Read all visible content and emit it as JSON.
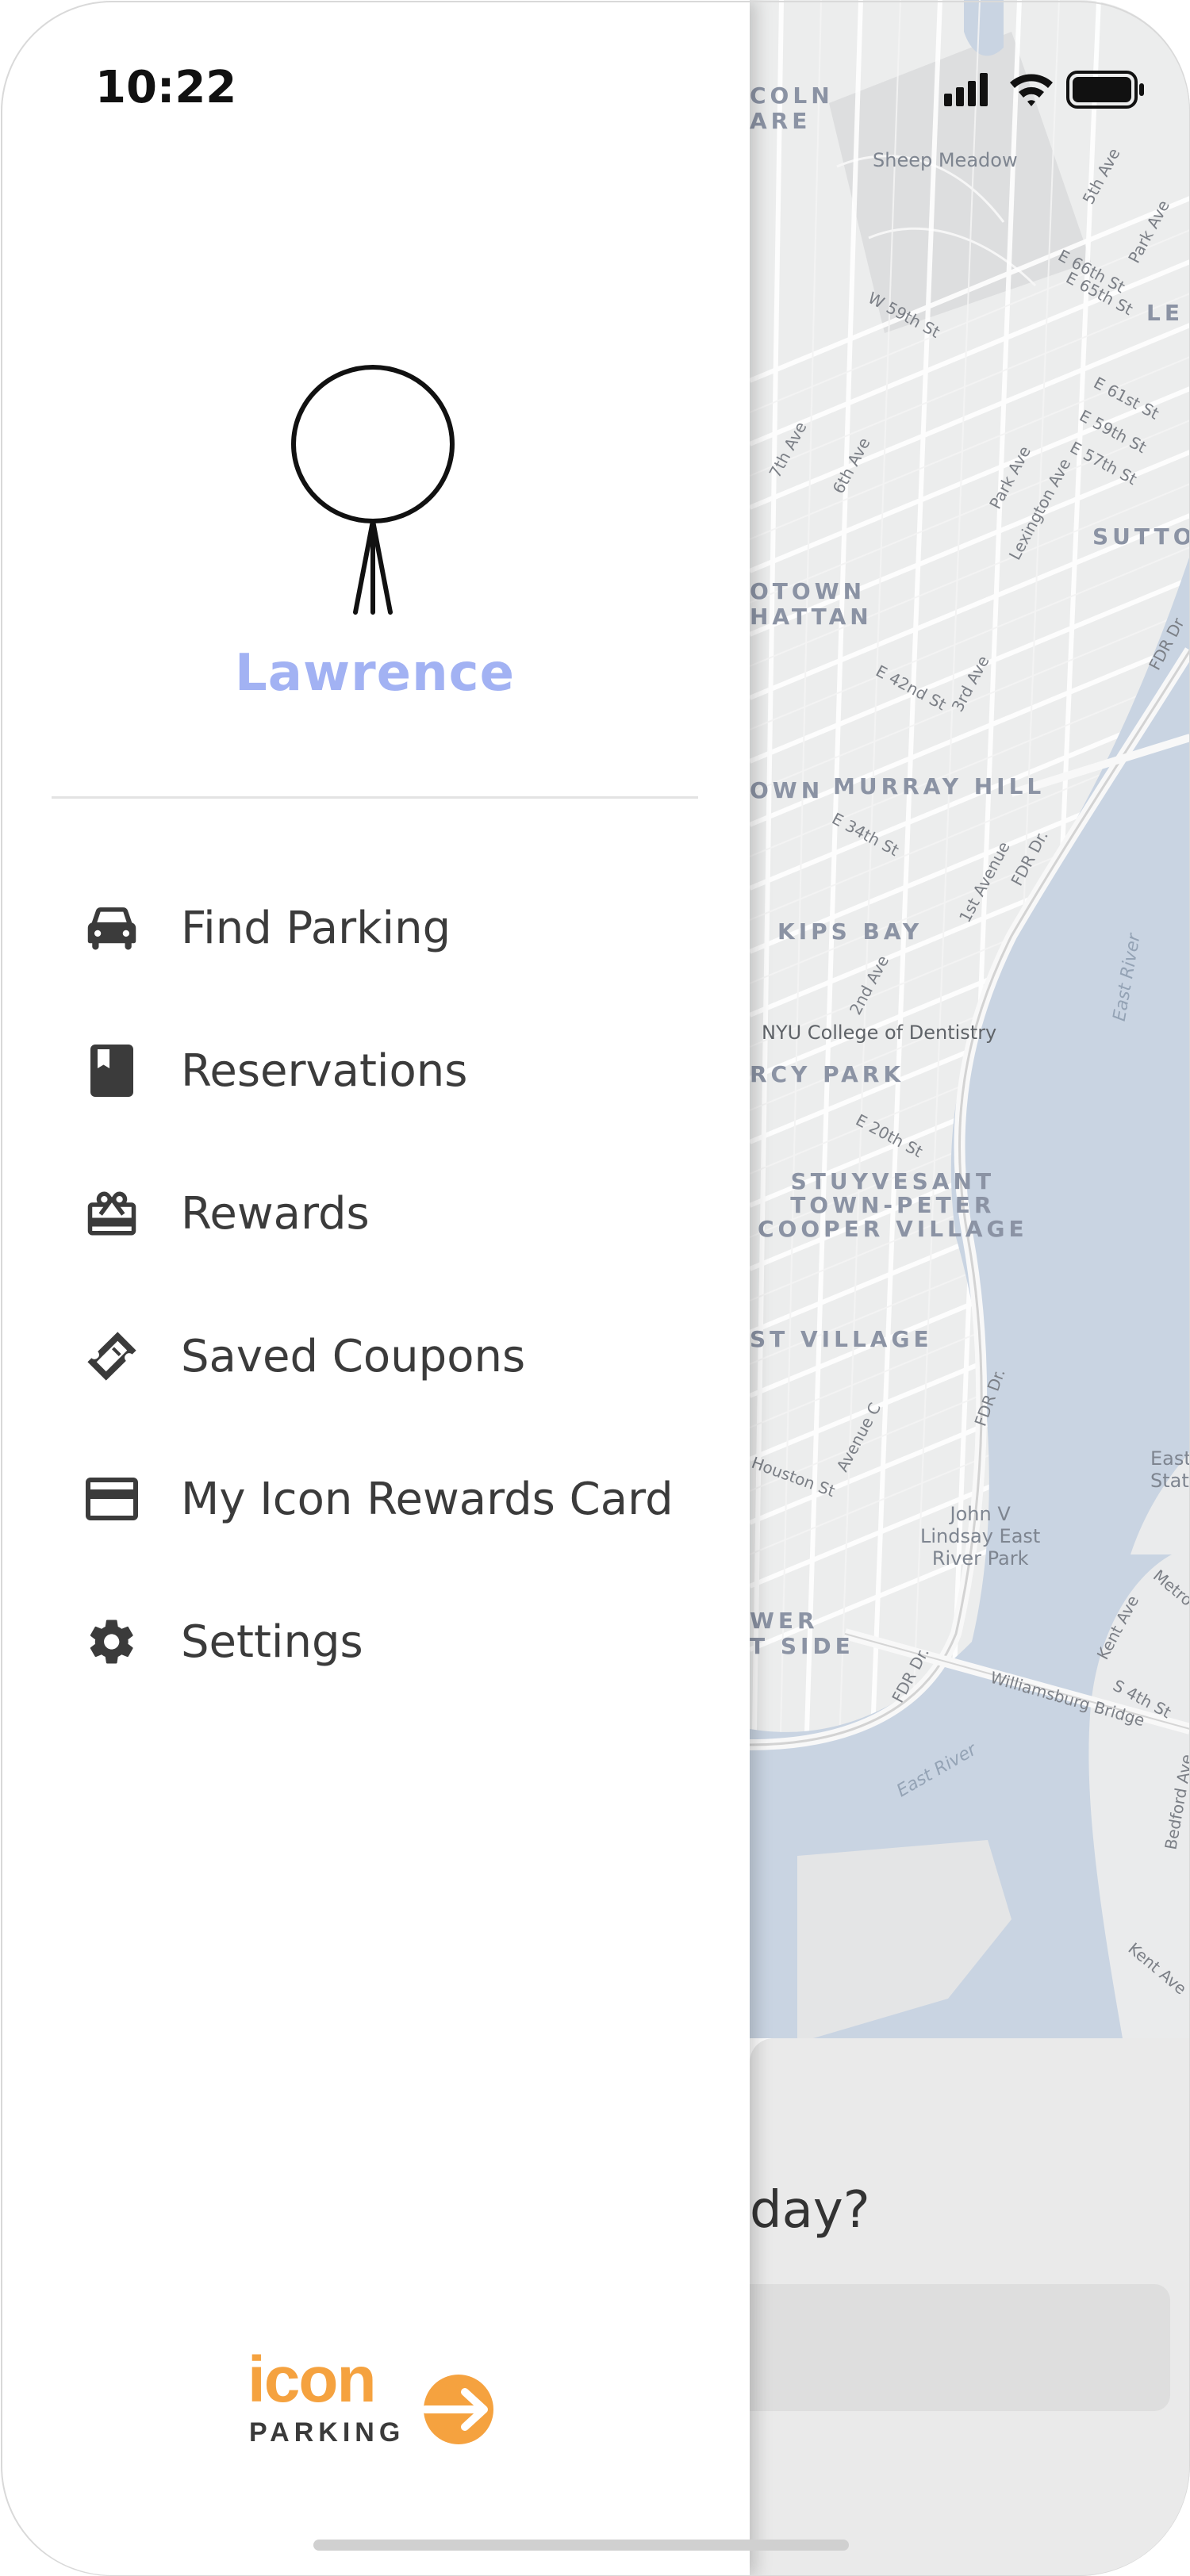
{
  "status_bar": {
    "time": "10:22"
  },
  "user": {
    "name": "Lawrence"
  },
  "menu": {
    "items": [
      {
        "label": "Find Parking",
        "icon": "car-icon"
      },
      {
        "label": "Reservations",
        "icon": "book-icon"
      },
      {
        "label": "Rewards",
        "icon": "gift-card-icon"
      },
      {
        "label": "Saved Coupons",
        "icon": "ticket-icon"
      },
      {
        "label": "My Icon Rewards Card",
        "icon": "credit-card-icon"
      },
      {
        "label": "Settings",
        "icon": "gear-icon"
      }
    ]
  },
  "logo": {
    "word": "icon",
    "sub": "PARKING",
    "color": "#f5a23f"
  },
  "map": {
    "labels": {
      "lincoln_square": "COLN\nARE",
      "sheep_meadow": "Sheep Meadow",
      "midtown": "OTOWN\nHATTAN",
      "murray_hill": "MURRAY HILL",
      "kips_bay": "KIPS BAY",
      "nyu": "NYU College of Dentistry",
      "gramercy": "RCY PARK",
      "stuyvesant": "STUYVESANT\nTOWN-PETER\nCOOPER VILLAGE",
      "east_village": "ST VILLAGE",
      "lower_east": "WER\nT SIDE",
      "john_v": "John V\nLindsay East\nRiver Park",
      "sutton": "SUTTO",
      "lenox": "LE",
      "town": "OWN",
      "east_river_1": "East River",
      "east_river_2": "East River",
      "w59": "W 59th St",
      "e66": "E 66th St",
      "e65": "E 65th St",
      "e61": "E 61st St",
      "e59": "E 59th St",
      "e57": "E 57th St",
      "e42": "E 42nd St",
      "e34": "E 34th St",
      "e20": "E 20th St",
      "fifth": "5th Ave",
      "park": "Park Ave",
      "park2": "Park Ave",
      "lex": "Lexington Ave",
      "seventh": "7th Ave",
      "sixth": "6th Ave",
      "third": "3rd Ave",
      "second": "2nd Ave",
      "first": "1st Avenue",
      "fdr1": "FDR Dr.",
      "fdr2": "FDR Dr.",
      "fdr3": "FDR Dr.",
      "fdr4": "FDR Dr",
      "avec": "Avenue C",
      "houston": "Houston St",
      "williamsburg": "Williamsburg Bridge",
      "kent": "Kent Ave",
      "s4": "S 4th St",
      "bedford": "Bedford Ave",
      "kent2": "Kent Ave",
      "east_stat": "East\nStat",
      "metro": "Metro"
    }
  },
  "sheet": {
    "title_fragment": "day?"
  }
}
